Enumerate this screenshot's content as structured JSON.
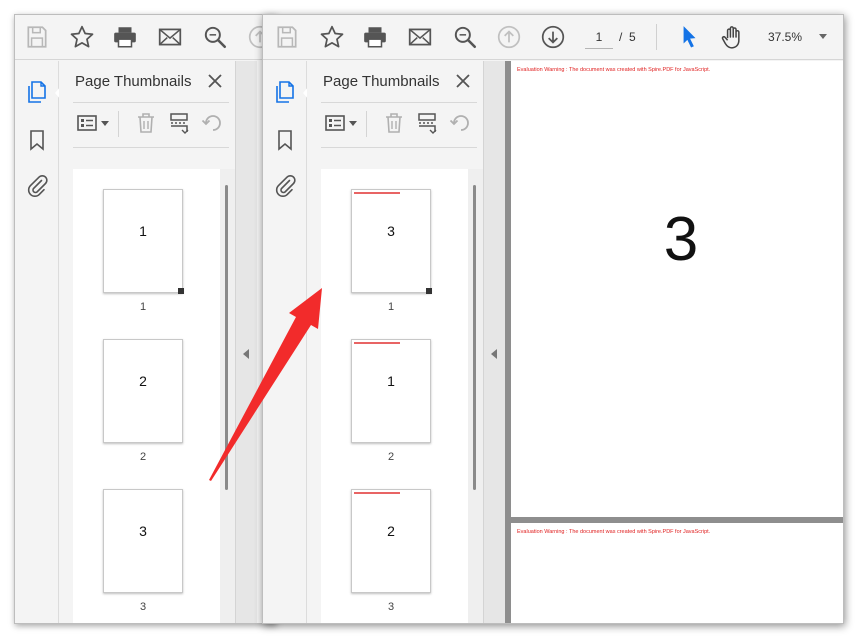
{
  "toolbar": {
    "current_page": "1",
    "page_separator": "/",
    "total_pages": "5",
    "zoom": "37.5%"
  },
  "panel": {
    "title": "Page Thumbnails"
  },
  "left_window": {
    "thumbnails": [
      {
        "content": "1",
        "label": "1"
      },
      {
        "content": "2",
        "label": "2"
      },
      {
        "content": "3",
        "label": "3"
      }
    ]
  },
  "right_window": {
    "thumbnails": [
      {
        "content": "3",
        "label": "1"
      },
      {
        "content": "1",
        "label": "2"
      },
      {
        "content": "2",
        "label": "3"
      }
    ],
    "document": {
      "page_number_text": "3",
      "evaluation_warning": "Evaluation Warning : The document was created with Spire.PDF for JavaScript."
    }
  },
  "colors": {
    "accent_blue": "#1473e6",
    "arrow_red": "#f22b2b",
    "warning_red": "#e02020"
  },
  "icons": [
    "save-icon",
    "star-icon",
    "print-icon",
    "mail-icon",
    "zoom-search-icon",
    "page-up-icon",
    "page-down-icon",
    "pointer-icon",
    "hand-icon",
    "pages-panel-icon",
    "bookmark-icon",
    "attachment-icon",
    "close-icon",
    "thumbnail-options-icon",
    "delete-icon",
    "insert-page-icon",
    "rotate-icon"
  ]
}
